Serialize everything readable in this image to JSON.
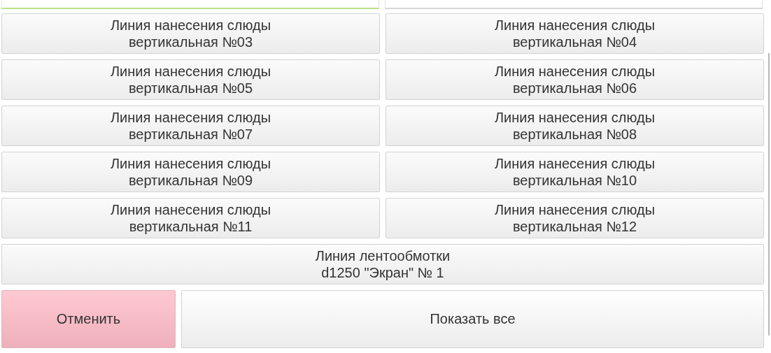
{
  "lines": [
    {
      "kind": "half",
      "title": "Линия нанесения слюды",
      "subtitle": "вертикальная №03"
    },
    {
      "kind": "half",
      "title": "Линия нанесения слюды",
      "subtitle": "вертикальная №04"
    },
    {
      "kind": "half",
      "title": "Линия нанесения слюды",
      "subtitle": "вертикальная №05"
    },
    {
      "kind": "half",
      "title": "Линия нанесения слюды",
      "subtitle": "вертикальная №06"
    },
    {
      "kind": "half",
      "title": "Линия нанесения слюды",
      "subtitle": "вертикальная №07"
    },
    {
      "kind": "half",
      "title": "Линия нанесения слюды",
      "subtitle": "вертикальная №08"
    },
    {
      "kind": "half",
      "title": "Линия нанесения слюды",
      "subtitle": "вертикальная №09"
    },
    {
      "kind": "half",
      "title": "Линия нанесения слюды",
      "subtitle": "вертикальная №10"
    },
    {
      "kind": "half",
      "title": "Линия нанесения слюды",
      "subtitle": "вертикальная №11"
    },
    {
      "kind": "half",
      "title": "Линия нанесения слюды",
      "subtitle": "вертикальная №12"
    },
    {
      "kind": "wide",
      "title": "Линия лентообмотки",
      "subtitle": "d1250 \"Экран\" № 1"
    }
  ],
  "actions": [
    {
      "kind": "cancel",
      "label": "Отменить"
    },
    {
      "kind": "show_all",
      "label": "Показать все"
    }
  ]
}
